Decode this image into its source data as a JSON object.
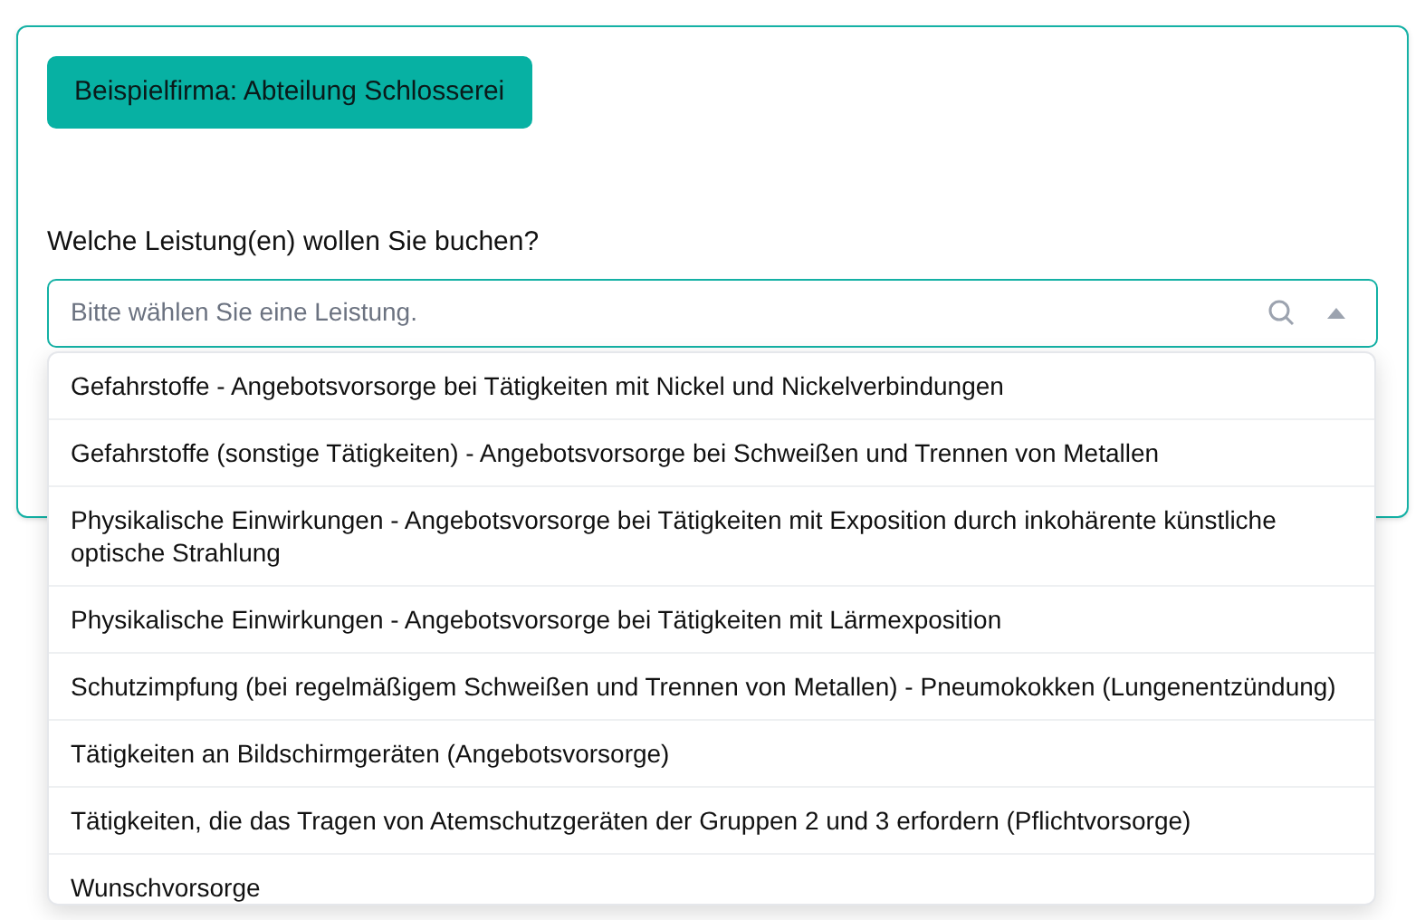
{
  "company_button": "Beispielfirma: Abteilung Schlosserei",
  "question": "Welche Leistung(en) wollen Sie buchen?",
  "select": {
    "placeholder": "Bitte wählen Sie eine Leistung.",
    "expanded": true
  },
  "options": [
    {
      "label": "Gefahrstoffe - Angebotsvorsorge bei Tätigkeiten mit Nickel und Nickelverbindungen"
    },
    {
      "label": "Gefahrstoffe (sonstige Tätigkeiten) - Angebotsvorsorge bei Schweißen und Trennen von Metallen"
    },
    {
      "label": "Physikalische Einwirkungen - Angebotsvorsorge bei Tätigkeiten mit Exposition durch inkohärente künstliche optische Strahlung"
    },
    {
      "label": "Physikalische Einwirkungen - Angebotsvorsorge bei Tätigkeiten mit Lärmexposition"
    },
    {
      "label": "Schutzimpfung (bei regelmäßigem Schweißen und Trennen von Metallen) - Pneumokokken (Lungenentzündung)"
    },
    {
      "label": "Tätigkeiten an Bildschirmgeräten (Angebotsvorsorge)"
    },
    {
      "label": "Tätigkeiten, die das Tragen von Atemschutzgeräten der Gruppen 2 und 3 erfordern (Pflichtvorsorge)"
    },
    {
      "label": "Wunschvorsorge"
    }
  ]
}
